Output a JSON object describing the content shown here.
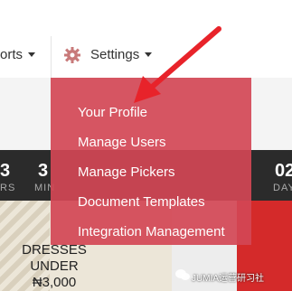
{
  "nav": {
    "reports_label": "orts",
    "settings_label": "Settings"
  },
  "dropdown": {
    "items": [
      {
        "label": "Your Profile"
      },
      {
        "label": "Manage Users"
      },
      {
        "label": "Manage Pickers"
      },
      {
        "label": "Document Templates"
      },
      {
        "label": "Integration Management"
      }
    ]
  },
  "countdown": {
    "left_num": "3",
    "left_unit": "RS",
    "mid_num": "3",
    "mid_unit": "MIN",
    "right_num": "02",
    "right_unit": "DAY"
  },
  "banner": {
    "line1": "DRESSES",
    "line2": "UNDER",
    "price": "₦3,000"
  },
  "watermark": {
    "text": "JUMIA运营研习社"
  },
  "colors": {
    "dropdown_bg": "#d24655",
    "arrow": "#e8232a"
  }
}
